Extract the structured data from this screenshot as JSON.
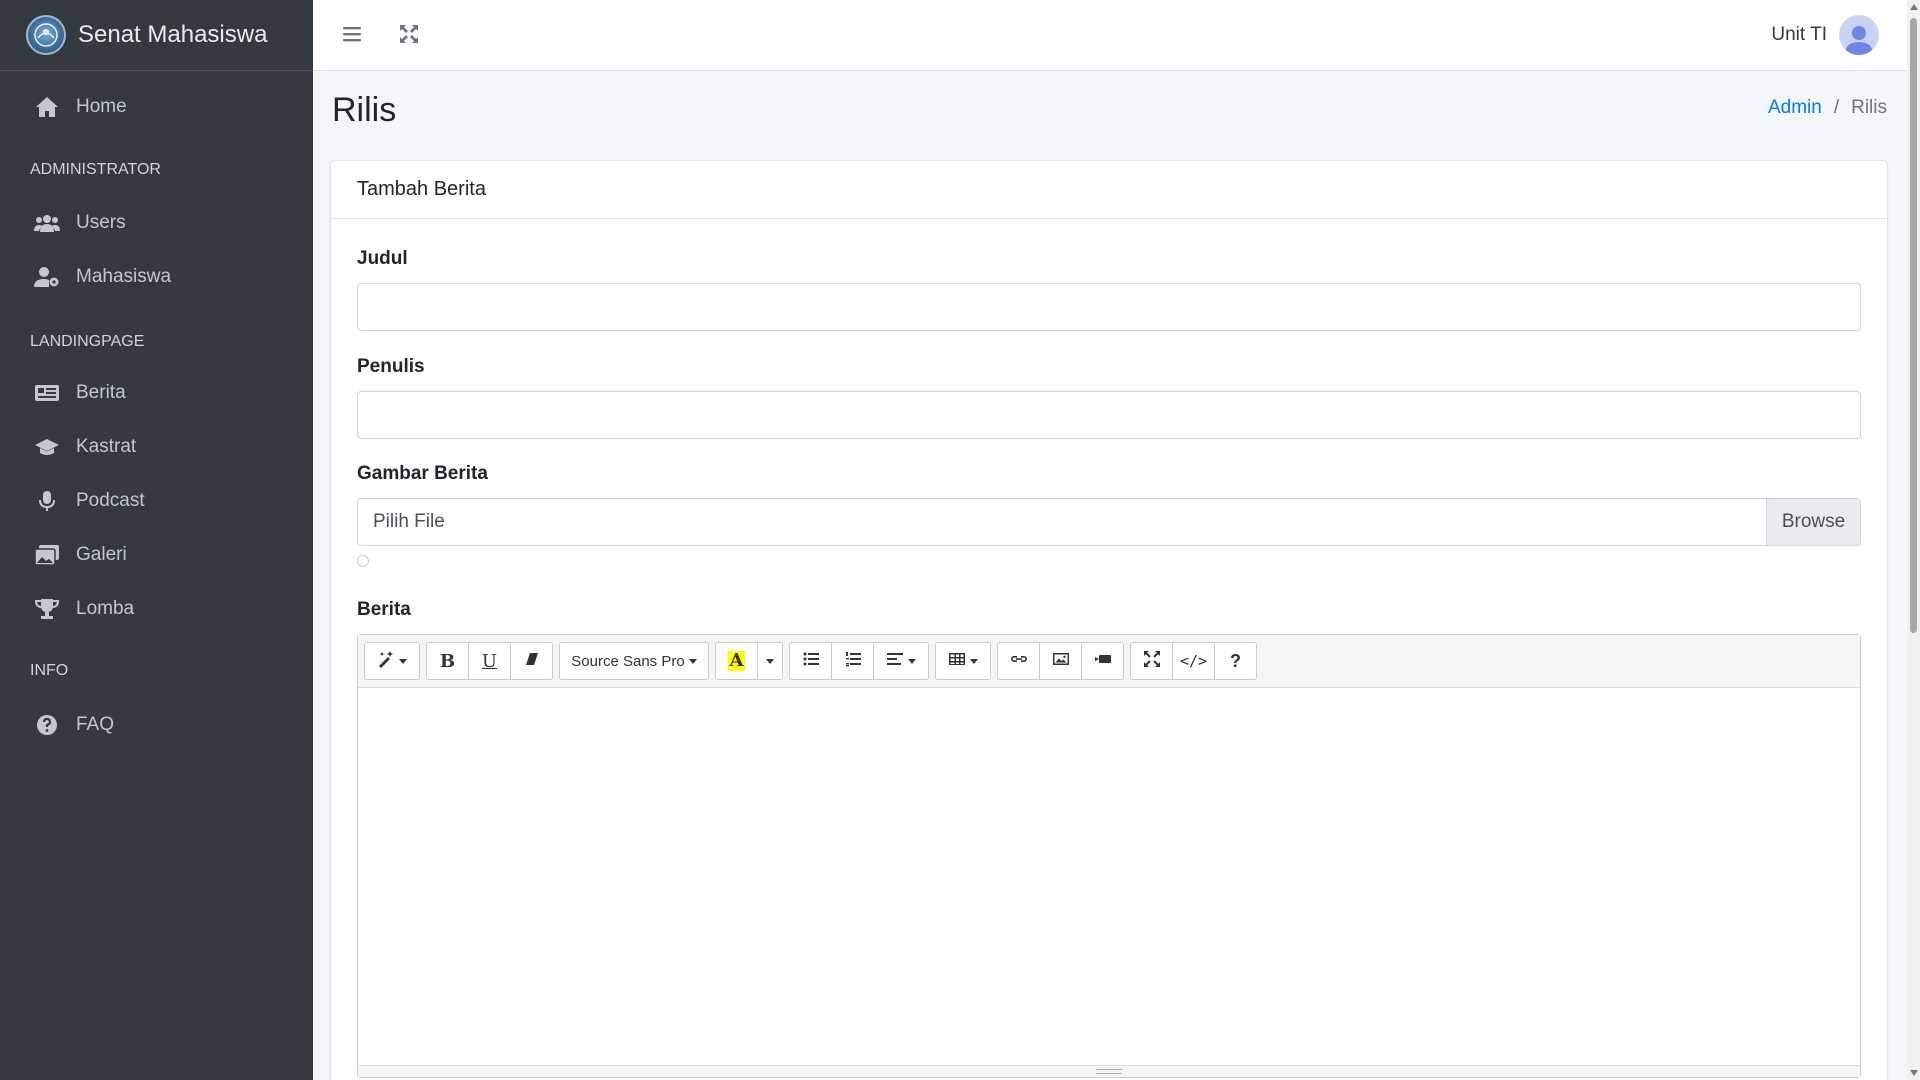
{
  "brand": {
    "name": "Senat Mahasiswa"
  },
  "sidebar": {
    "home": {
      "label": "Home",
      "icon": "home-icon"
    },
    "sections": [
      {
        "header": "ADMINISTRATOR"
      },
      {
        "header": "LANDINGPAGE"
      },
      {
        "header": "INFO"
      }
    ],
    "items": [
      {
        "label": "Users",
        "icon": "users-icon"
      },
      {
        "label": "Mahasiswa",
        "icon": "user-cog-icon"
      },
      {
        "label": "Berita",
        "icon": "newspaper-icon"
      },
      {
        "label": "Kastrat",
        "icon": "graduation-cap-icon"
      },
      {
        "label": "Podcast",
        "icon": "microphone-icon"
      },
      {
        "label": "Galeri",
        "icon": "images-icon"
      },
      {
        "label": "Lomba",
        "icon": "trophy-icon"
      },
      {
        "label": "FAQ",
        "icon": "question-circle-icon"
      }
    ]
  },
  "topbar": {
    "menu_icon": "hamburger-icon",
    "fullscreen_icon": "expand-icon",
    "user_name": "Unit TI"
  },
  "page": {
    "title": "Rilis",
    "breadcrumb": [
      "Admin",
      "/",
      "Rilis"
    ]
  },
  "card": {
    "title": "Tambah Berita",
    "fields": {
      "judul": {
        "label": "Judul",
        "value": ""
      },
      "penulis": {
        "label": "Penulis",
        "value": ""
      },
      "gambar": {
        "label": "Gambar Berita",
        "placeholder": "Pilih File",
        "button": "Browse"
      },
      "berita": {
        "label": "Berita"
      }
    },
    "editor": {
      "font_name": "Source Sans Pro",
      "highlight_color": "#ffff00"
    }
  }
}
